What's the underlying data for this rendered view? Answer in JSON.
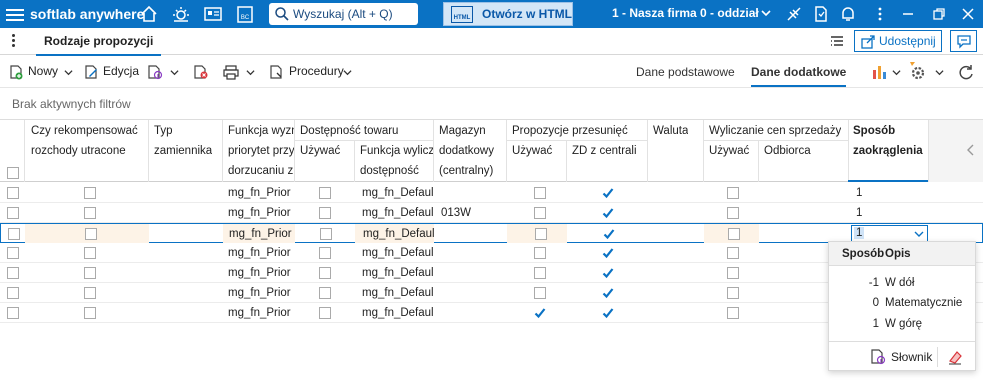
{
  "app": {
    "name": "softlab anywhere"
  },
  "search": {
    "placeholder": "Wyszukaj (Alt + Q)"
  },
  "open_html": {
    "label": "Otwórz w HTML",
    "badge": "HTML"
  },
  "company": "1 - Nasza firma 0 - oddział",
  "tab": {
    "label": "Rodzaje propozycji"
  },
  "share": {
    "label": "Udostępnij"
  },
  "toolbar": {
    "new": "Nowy",
    "edit": "Edycja",
    "procedures": "Procedury"
  },
  "data_tabs": {
    "basic": "Dane podstawowe",
    "extra": "Dane dodatkowe"
  },
  "filters": "Brak aktywnych filtrów",
  "headers": {
    "kompensacja": [
      "Czy rekompensować",
      "rozchody utracone"
    ],
    "typ": [
      "Typ",
      "zamiennika"
    ],
    "funkcja": [
      "Funkcja wyzn",
      "priorytet przy",
      "dorzucaniu z"
    ],
    "dostepnosc_group": "Dostępność towaru",
    "dost_uzywac": "Używać",
    "dost_funkcja": [
      "Funkcja wylicz",
      "dostępność"
    ],
    "magazyn": [
      "Magazyn",
      "dodatkowy",
      "(centralny)"
    ],
    "przes_group": "Propozycje przesunięć",
    "przes_uzywac": "Używać",
    "przes_zd": "ZD z centrali",
    "waluta": "Waluta",
    "wylicz_group": "Wyliczanie cen sprzedaży",
    "wylicz_uzywac": "Używać",
    "odbiorca": "Odbiorca",
    "sposob": [
      "Sposób",
      "zaokrąglenia"
    ]
  },
  "rows": [
    {
      "funkcja": "mg_fn_Prior",
      "dost_funkcja": "mg_fn_Defaul",
      "magazyn": "",
      "przes_uzywac": false,
      "zd": true,
      "sposob": "1"
    },
    {
      "funkcja": "mg_fn_Prior",
      "dost_funkcja": "mg_fn_Defaul",
      "magazyn": "013W",
      "przes_uzywac": false,
      "zd": true,
      "sposob": "1"
    },
    {
      "funkcja": "mg_fn_Prior",
      "dost_funkcja": "mg_fn_Defaul",
      "magazyn": "",
      "przes_uzywac": false,
      "zd": true,
      "sposob": "1"
    },
    {
      "funkcja": "mg_fn_Prior",
      "dost_funkcja": "mg_fn_Defaul",
      "magazyn": "",
      "przes_uzywac": false,
      "zd": true,
      "sposob": ""
    },
    {
      "funkcja": "mg_fn_Prior",
      "dost_funkcja": "mg_fn_Defaul",
      "magazyn": "",
      "przes_uzywac": false,
      "zd": true,
      "sposob": ""
    },
    {
      "funkcja": "mg_fn_Prior",
      "dost_funkcja": "mg_fn_Defaul",
      "magazyn": "",
      "przes_uzywac": false,
      "zd": true,
      "sposob": ""
    },
    {
      "funkcja": "mg_fn_Prior",
      "dost_funkcja": "mg_fn_Defaul",
      "magazyn": "",
      "przes_uzywac": true,
      "zd": true,
      "sposob": ""
    }
  ],
  "dropdown": {
    "col1": "Sposób",
    "col2": "Opis",
    "options": [
      {
        "value": "-1",
        "label": "W dół"
      },
      {
        "value": "0",
        "label": "Matematycznie"
      },
      {
        "value": "1",
        "label": "W górę"
      }
    ],
    "dict_label": "Słownik"
  },
  "colors": {
    "accent": "#0a72c4",
    "check": "#0a72c4",
    "row_tint": "#fdf3e7"
  }
}
